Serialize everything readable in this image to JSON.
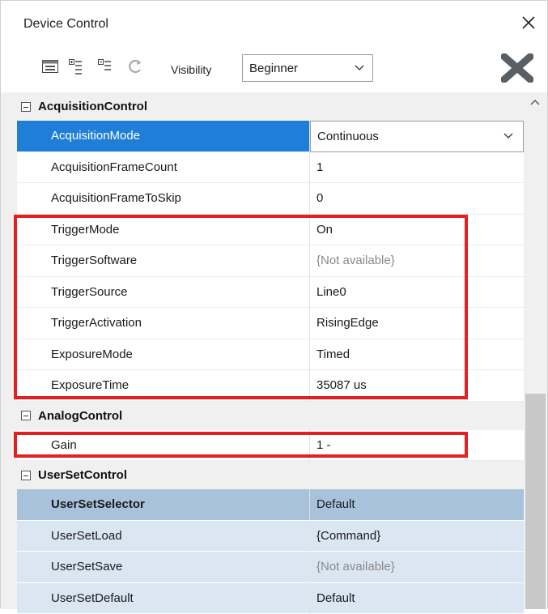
{
  "window": {
    "title": "Device Control"
  },
  "toolbar": {
    "visibility_label": "Visibility",
    "visibility_value": "Beginner"
  },
  "categories": {
    "acquisition": "AcquisitionControl",
    "analog": "AnalogControl",
    "userset": "UserSetControl"
  },
  "acquisition_rows": [
    {
      "name": "AcquisitionMode",
      "value": "Continuous"
    },
    {
      "name": "AcquisitionFrameCount",
      "value": "1"
    },
    {
      "name": "AcquisitionFrameToSkip",
      "value": "0"
    },
    {
      "name": "TriggerMode",
      "value": "On"
    },
    {
      "name": "TriggerSoftware",
      "value": "{Not available}"
    },
    {
      "name": "TriggerSource",
      "value": "Line0"
    },
    {
      "name": "TriggerActivation",
      "value": "RisingEdge"
    },
    {
      "name": "ExposureMode",
      "value": "Timed"
    },
    {
      "name": "ExposureTime",
      "value": "35087 us"
    }
  ],
  "analog_rows": [
    {
      "name": "Gain",
      "value": "1 -"
    }
  ],
  "userset_rows": [
    {
      "name": "UserSetSelector",
      "value": "Default"
    },
    {
      "name": "UserSetLoad",
      "value": "{Command}"
    },
    {
      "name": "UserSetSave",
      "value": "{Not available}"
    },
    {
      "name": "UserSetDefault",
      "value": "Default"
    }
  ],
  "colors": {
    "selected_row": "#1f7fd8",
    "highlight_box": "#e41f1f",
    "userset_header": "#a8c2dc",
    "userset_row": "#dbe6f3"
  }
}
